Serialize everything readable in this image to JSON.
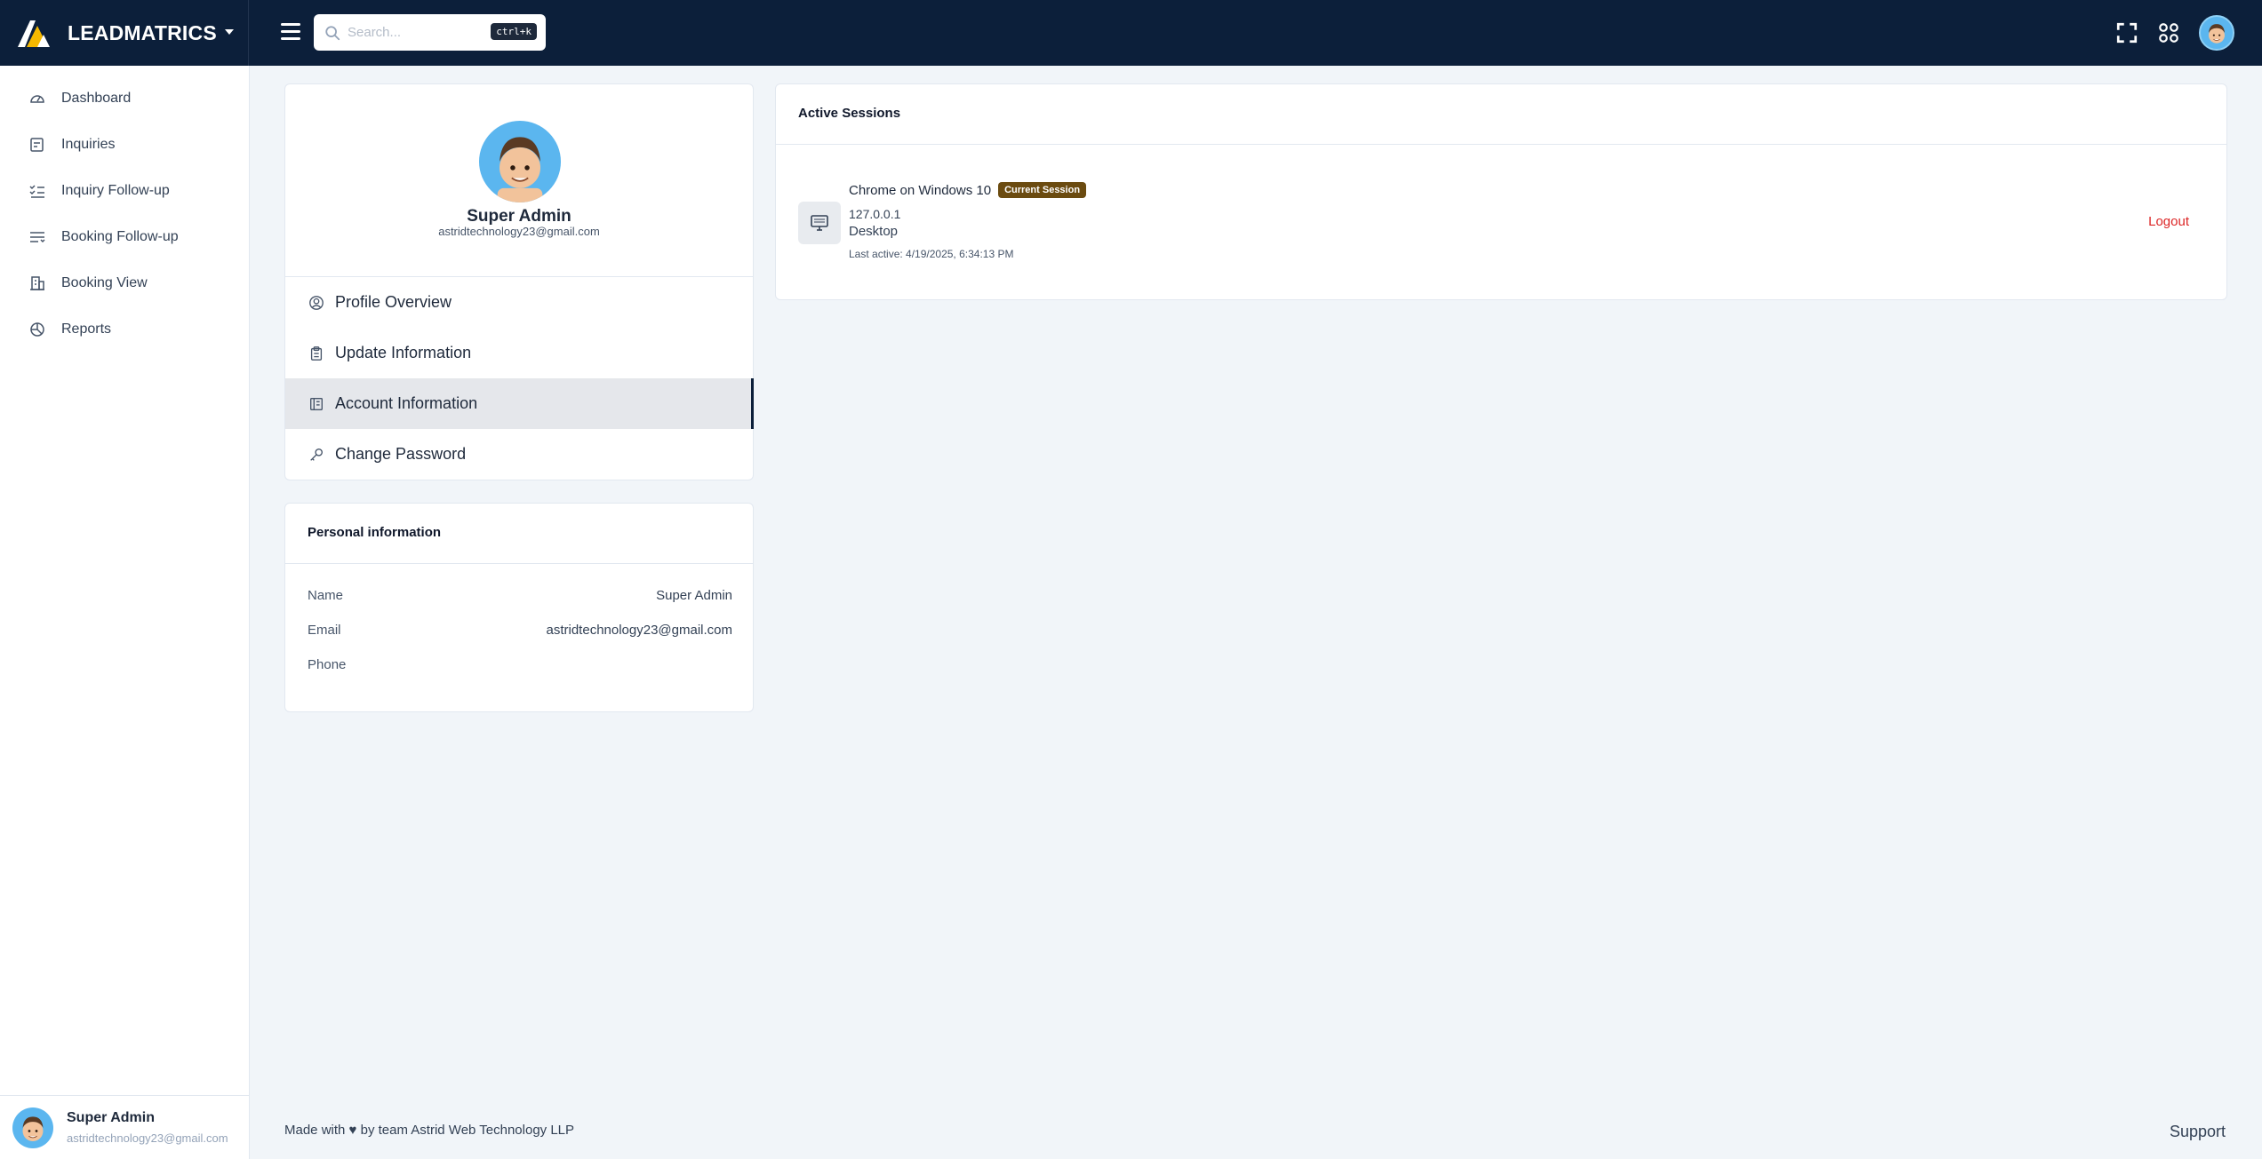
{
  "app": {
    "brand": "LEADMATRICS",
    "search_placeholder": "Search...",
    "search_shortcut": "ctrl+k"
  },
  "sidebar": {
    "items": [
      {
        "label": "Dashboard",
        "icon": "gauge-icon"
      },
      {
        "label": "Inquiries",
        "icon": "inquiry-icon"
      },
      {
        "label": "Inquiry Follow-up",
        "icon": "list-check-icon"
      },
      {
        "label": "Booking Follow-up",
        "icon": "list-lines-icon"
      },
      {
        "label": "Booking View",
        "icon": "building-icon"
      },
      {
        "label": "Reports",
        "icon": "chart-pie-icon"
      }
    ],
    "user": {
      "name": "Super Admin",
      "email": "astridtechnology23@gmail.com"
    }
  },
  "profile": {
    "name": "Super Admin",
    "email": "astridtechnology23@gmail.com",
    "menu": [
      {
        "label": "Profile Overview",
        "icon": "user-circle-icon"
      },
      {
        "label": "Update Information",
        "icon": "clipboard-icon"
      },
      {
        "label": "Account Information",
        "icon": "book-icon"
      },
      {
        "label": "Change Password",
        "icon": "key-icon"
      }
    ],
    "active_menu": "Account Information"
  },
  "personal_info": {
    "title": "Personal information",
    "rows": [
      {
        "label": "Name",
        "value": "Super Admin"
      },
      {
        "label": "Email",
        "value": "astridtechnology23@gmail.com"
      },
      {
        "label": "Phone",
        "value": ""
      }
    ]
  },
  "sessions": {
    "title": "Active Sessions",
    "items": [
      {
        "browser": "Chrome on Windows 10",
        "badge": "Current Session",
        "ip": "127.0.0.1",
        "device": "Desktop",
        "last_active": "Last active: 4/19/2025, 6:34:13 PM",
        "action": "Logout"
      }
    ]
  },
  "footer": {
    "credit": "Made with ♥ by team Astrid Web Technology LLP",
    "support": "Support"
  },
  "colors": {
    "header_bg": "#0c1f3a",
    "page_bg": "#f1f5f9",
    "badge_bg": "#6b4b10",
    "logout": "#dc2626",
    "avatar_bg": "#5bb6ef"
  }
}
